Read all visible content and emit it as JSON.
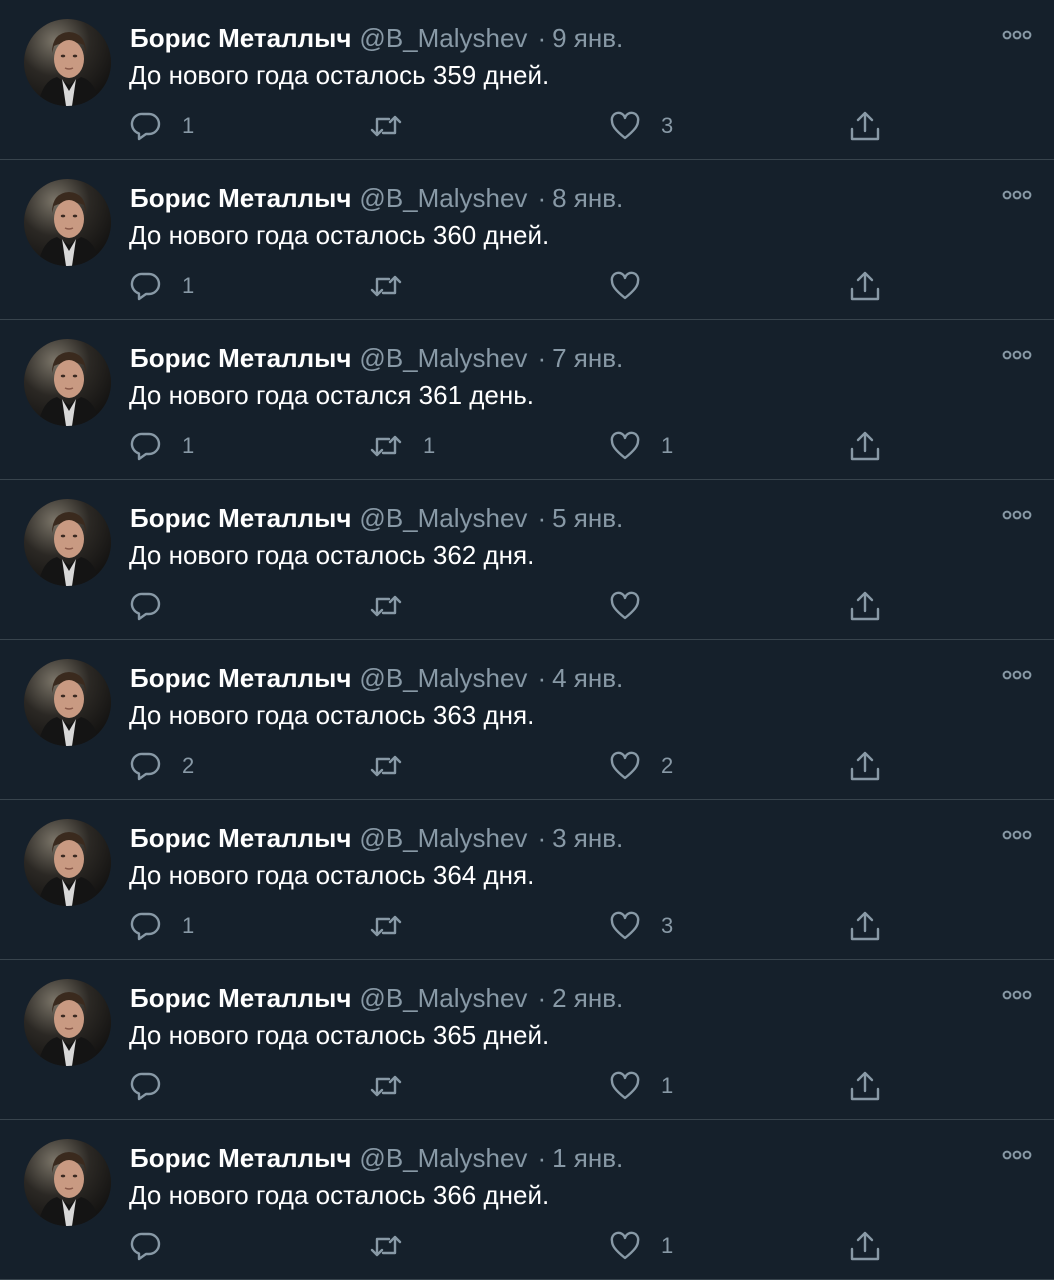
{
  "tweets": [
    {
      "author": "Борис Металлыч",
      "handle": "@B_Malyshev",
      "separator": "·",
      "date": "9 янв.",
      "text": "До нового года осталось 359 дней.",
      "replies": "1",
      "retweets": "",
      "likes": "3"
    },
    {
      "author": "Борис Металлыч",
      "handle": "@B_Malyshev",
      "separator": "·",
      "date": "8 янв.",
      "text": "До нового года осталось 360 дней.",
      "replies": "1",
      "retweets": "",
      "likes": ""
    },
    {
      "author": "Борис Металлыч",
      "handle": "@B_Malyshev",
      "separator": "·",
      "date": "7 янв.",
      "text": "До нового года остался 361 день.",
      "replies": "1",
      "retweets": "1",
      "likes": "1"
    },
    {
      "author": "Борис Металлыч",
      "handle": "@B_Malyshev",
      "separator": "·",
      "date": "5 янв.",
      "text": "До нового года осталось 362 дня.",
      "replies": "",
      "retweets": "",
      "likes": ""
    },
    {
      "author": "Борис Металлыч",
      "handle": "@B_Malyshev",
      "separator": "·",
      "date": "4 янв.",
      "text": "До нового года осталось 363 дня.",
      "replies": "2",
      "retweets": "",
      "likes": "2"
    },
    {
      "author": "Борис Металлыч",
      "handle": "@B_Malyshev",
      "separator": "·",
      "date": "3 янв.",
      "text": "До нового года осталось 364 дня.",
      "replies": "1",
      "retweets": "",
      "likes": "3"
    },
    {
      "author": "Борис Металлыч",
      "handle": "@B_Malyshev",
      "separator": "·",
      "date": "2 янв.",
      "text": "До нового года осталось 365 дней.",
      "replies": "",
      "retweets": "",
      "likes": "1"
    },
    {
      "author": "Борис Металлыч",
      "handle": "@B_Malyshev",
      "separator": "·",
      "date": "1 янв.",
      "text": "До нового года осталось 366 дней.",
      "replies": "",
      "retweets": "",
      "likes": "1"
    }
  ],
  "icons": {
    "more": "more-dots-icon",
    "reply": "reply-icon",
    "retweet": "retweet-icon",
    "like": "heart-icon",
    "share": "share-icon"
  },
  "colors": {
    "background": "#15202b",
    "divider": "#38444d",
    "primary_text": "#ffffff",
    "secondary_text": "#8899a6"
  }
}
